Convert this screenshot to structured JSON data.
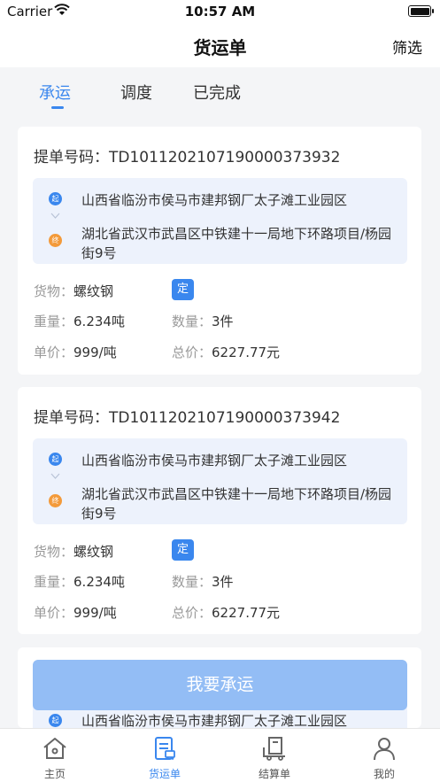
{
  "status_bar": {
    "carrier": "Carrier",
    "time": "10:57 AM"
  },
  "nav": {
    "title": "货运单",
    "filter": "筛选"
  },
  "tabs": [
    {
      "label": "承运",
      "active": true
    },
    {
      "label": "调度",
      "active": false
    },
    {
      "label": "已完成",
      "active": false
    }
  ],
  "labels": {
    "order_prefix": "提单号码：",
    "start_tag": "起",
    "end_tag": "终",
    "goods": "货物：",
    "weight": "重量：",
    "qty": "数量：",
    "unit_price": "单价：",
    "total_price": "总价：",
    "fixed_badge": "定"
  },
  "orders": [
    {
      "order_no": "TD1011202107190000373932",
      "from": "山西省临汾市侯马市建邦钢厂太子滩工业园区",
      "to": "湖北省武汉市武昌区中铁建十一局地下环路项目/杨园街9号",
      "goods": "螺纹钢",
      "weight": "6.234吨",
      "qty": "3件",
      "unit_price": "999/吨",
      "total_price": "6227.77元"
    },
    {
      "order_no": "TD1011202107190000373942",
      "from": "山西省临汾市侯马市建邦钢厂太子滩工业园区",
      "to": "湖北省武汉市武昌区中铁建十一局地下环路项目/杨园街9号",
      "goods": "螺纹钢",
      "weight": "6.234吨",
      "qty": "3件",
      "unit_price": "999/吨",
      "total_price": "6227.77元"
    },
    {
      "from": "山西省临汾市侯马市建邦钢厂太子滩工业园区"
    }
  ],
  "cta": {
    "label": "我要承运"
  },
  "tabbar": [
    {
      "label": "主页",
      "icon": "home-icon",
      "active": false
    },
    {
      "label": "货运单",
      "icon": "waybill-icon",
      "active": true
    },
    {
      "label": "结算单",
      "icon": "settlement-icon",
      "active": false
    },
    {
      "label": "我的",
      "icon": "user-icon",
      "active": false
    }
  ],
  "colors": {
    "accent": "#3a87ee",
    "end_dot": "#f39a3a",
    "route_bg": "#edf2fc",
    "cta_bg": "#93bdf5"
  }
}
